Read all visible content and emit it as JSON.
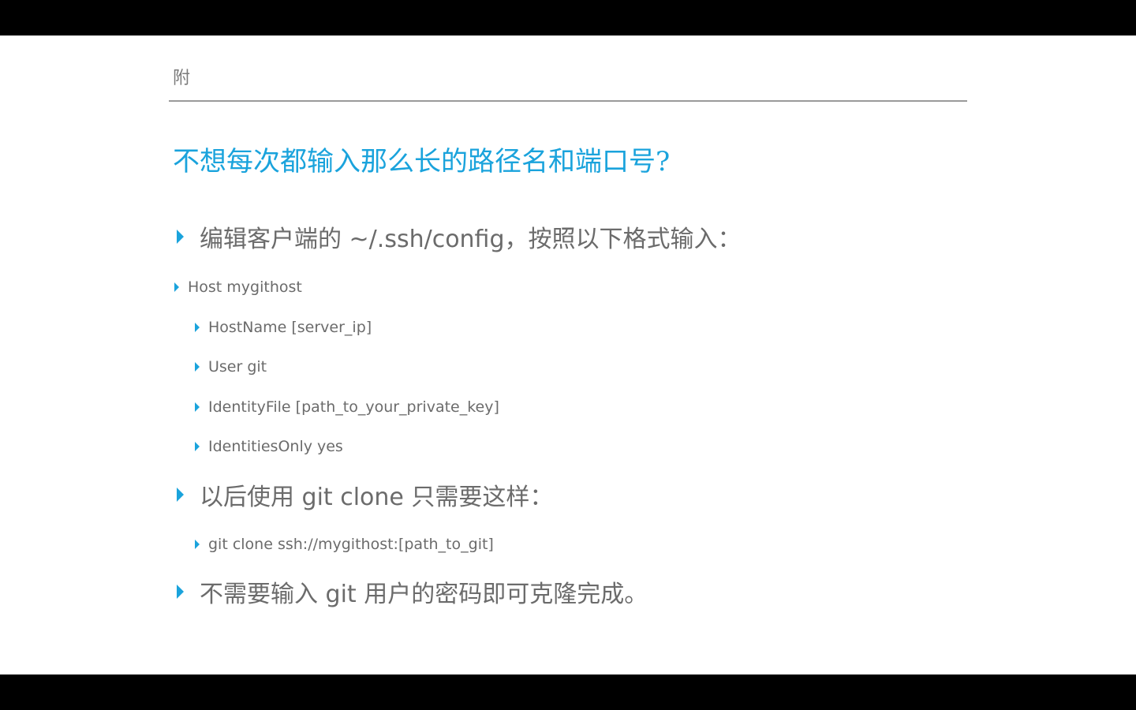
{
  "header": {
    "label": "附"
  },
  "slide": {
    "title": "不想每次都输入那么长的路径名和端口号?",
    "bullets": {
      "edit_config": "编辑客户端的 ~/.ssh/config，按照以下格式输入：",
      "host": "Host mygithost",
      "hostname": "HostName [server_ip]",
      "user": "User git",
      "identity_file": "IdentityFile [path_to_your_private_key]",
      "identities_only": "IdentitiesOnly yes",
      "clone_intro": "以后使用 git clone 只需要这样：",
      "clone_cmd": "git clone ssh://mygithost:[path_to_git]",
      "no_password": "不需要输入 git 用户的密码即可克隆完成。"
    }
  },
  "colors": {
    "accent": "#1aa3dc",
    "body_text": "#6b6b6b",
    "header_text": "#7a7a7a",
    "rule": "#9a9a9a",
    "background": "#ffffff",
    "letterbox": "#000000"
  }
}
